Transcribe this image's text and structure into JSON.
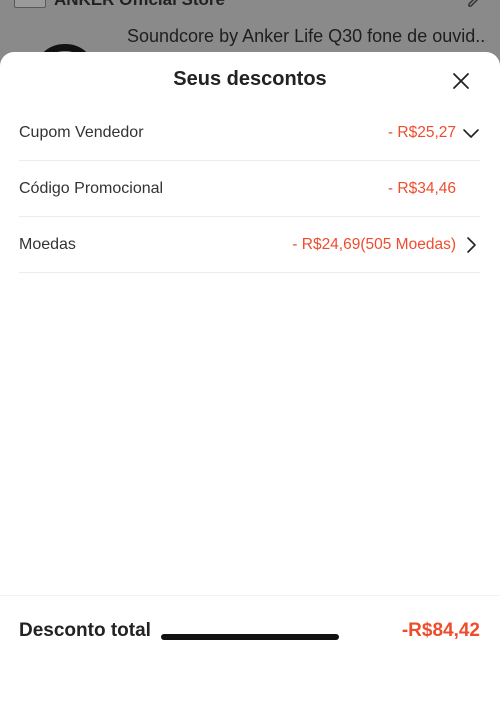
{
  "background": {
    "store_name": "ANKER Official Store",
    "product_title": "Soundcore by Anker Life Q30 fone de ouvid..."
  },
  "sheet": {
    "title": "Seus descontos",
    "rows": [
      {
        "label": "Cupom Vendedor",
        "value": "- R$25,27",
        "icon": "chevron-down-icon"
      },
      {
        "label": "Código Promocional",
        "value": "- R$34,46",
        "icon": ""
      },
      {
        "label": "Moedas",
        "value": "- R$24,69(505 Moedas)",
        "icon": "chevron-right-icon"
      }
    ]
  },
  "footer": {
    "total_label": "Desconto total",
    "total_value": "-R$84,42"
  },
  "colors": {
    "accent": "#ee4d2d",
    "overlay": "#8a8a8a",
    "text": "#222222"
  }
}
